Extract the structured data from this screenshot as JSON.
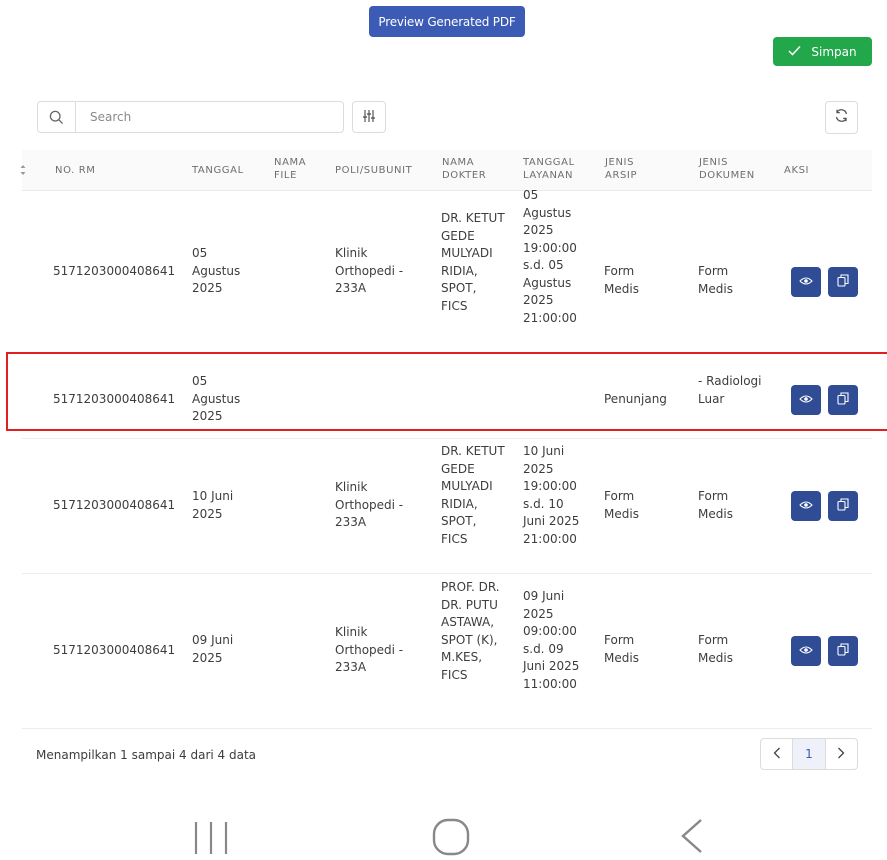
{
  "toolbar": {
    "preview_label": "Preview Generated PDF",
    "save_label": "Simpan"
  },
  "search": {
    "placeholder": "Search",
    "value": ""
  },
  "table": {
    "columns": [
      "NO. RM",
      "TANGGAL",
      "NAMA FILE",
      "POLI/SUBUNIT",
      "NAMA DOKTER",
      "TANGGAL LAYANAN",
      "JENIS ARSIP",
      "JENIS DOKUMEN",
      "AKSI"
    ],
    "rows": [
      {
        "no_rm": "5171203000408641",
        "tanggal": "05 Agustus 2025",
        "nama_file": "",
        "poli": "Klinik Orthopedi - 233A",
        "dokter": "DR. KETUT GEDE MULYADI RIDIA, SPOT, FICS",
        "layanan": "05 Agustus 2025 19:00:00 s.d. 05 Agustus 2025 21:00:00",
        "arsip": "Form Medis",
        "dokumen": "Form Medis"
      },
      {
        "no_rm": "5171203000408641",
        "tanggal": "05 Agustus 2025",
        "nama_file": "",
        "poli": "",
        "dokter": "",
        "layanan": "",
        "arsip": "Penunjang",
        "dokumen": "- Radiologi Luar"
      },
      {
        "no_rm": "5171203000408641",
        "tanggal": "10 Juni 2025",
        "nama_file": "",
        "poli": "Klinik Orthopedi - 233A",
        "dokter": "DR. KETUT GEDE MULYADI RIDIA, SPOT, FICS",
        "layanan": "10 Juni 2025 19:00:00 s.d. 10 Juni 2025 21:00:00",
        "arsip": "Form Medis",
        "dokumen": "Form Medis"
      },
      {
        "no_rm": "5171203000408641",
        "tanggal": "09 Juni 2025",
        "nama_file": "",
        "poli": "Klinik Orthopedi - 233A",
        "dokter": "PROF. DR. DR. PUTU ASTAWA, SPOT (K), M.KES, FICS",
        "layanan": "09 Juni 2025 09:00:00 s.d. 09 Juni 2025 11:00:00",
        "arsip": "Form Medis",
        "dokumen": "Form Medis"
      }
    ]
  },
  "footer": {
    "summary": "Menampilkan 1 sampai 4 dari 4 data"
  },
  "pagination": {
    "current_page": "1"
  },
  "colors": {
    "primary": "#3b5bb5",
    "action": "#2f4c94",
    "save": "#22a84a",
    "highlight": "#e02020"
  },
  "icons": {
    "search": "search-icon",
    "filter": "sliders-icon",
    "refresh": "refresh-icon",
    "view": "eye-icon",
    "copy": "copy-icon",
    "check": "check-icon",
    "prev": "chevron-left-icon",
    "next": "chevron-right-icon"
  }
}
